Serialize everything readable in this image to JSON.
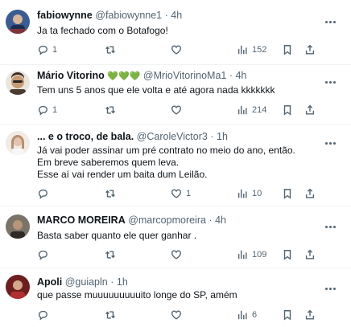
{
  "tweets": [
    {
      "name": "fabiowynne",
      "handle": "@fabiowynne1",
      "time": "4h",
      "text": [
        "Ja ta fechado com o Botafogo!"
      ],
      "replies": "1",
      "retweets": "",
      "likes": "",
      "views": "152",
      "avatar_color": "#2b4a7a"
    },
    {
      "name": "Mário Vitorino",
      "hearts": "💚💚💚",
      "handle": "@MrioVitorinoMa1",
      "time": "4h",
      "text": [
        "Tem uns 5 anos que ele volta e até agora nada kkkkkkk"
      ],
      "replies": "1",
      "retweets": "",
      "likes": "",
      "views": "214",
      "avatar_color": "#c9a27e"
    },
    {
      "name": "... e o troco, de bala.",
      "handle": "@CaroleVictor3",
      "time": "1h",
      "text": [
        "Já vai poder assinar um pré contrato no meio do ano, então.",
        "Em breve saberemos quem leva.",
        "Esse aí vai render um baita dum Leilão."
      ],
      "replies": "",
      "retweets": "",
      "likes": "1",
      "views": "10",
      "avatar_color": "#e8dcd6"
    },
    {
      "name": "MARCO MOREIRA",
      "handle": "@marcopmoreira",
      "time": "4h",
      "text": [
        "Basta saber quanto ele quer ganhar ."
      ],
      "replies": "",
      "retweets": "",
      "likes": "",
      "views": "109",
      "avatar_color": "#6b6258"
    },
    {
      "name": "Apoli",
      "handle": "@guiapln",
      "time": "1h",
      "text": [
        "que passe muuuuuuuuuito longe do SP, amém"
      ],
      "replies": "",
      "retweets": "",
      "likes": "",
      "views": "6",
      "avatar_color": "#8a2a2a"
    }
  ]
}
